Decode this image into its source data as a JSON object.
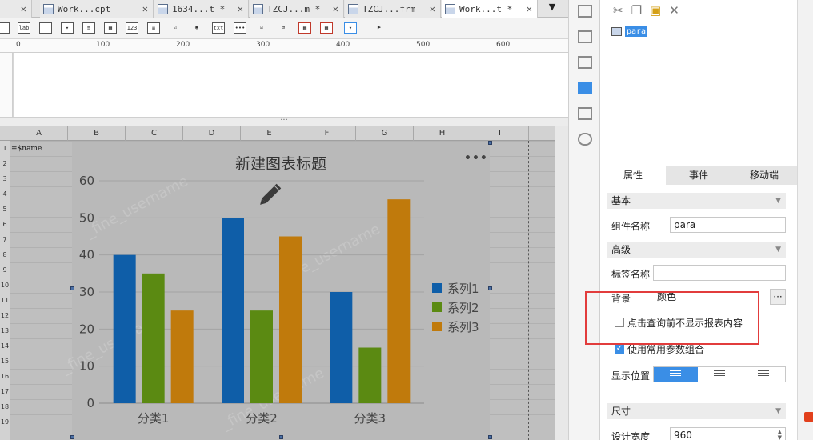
{
  "tabs": [
    {
      "label": "Work...cpt",
      "active": false
    },
    {
      "label": "1634...t *",
      "active": false
    },
    {
      "label": "TZCJ...m *",
      "active": false
    },
    {
      "label": "TZCJ...frm",
      "active": false
    },
    {
      "label": "Work...t *",
      "active": true
    }
  ],
  "toolbar_labels": {
    "lab": "lab",
    "num": "123",
    "txt": "txt"
  },
  "ruler": [
    "0",
    "100",
    "200",
    "300",
    "400",
    "500",
    "600"
  ],
  "columns": [
    "A",
    "B",
    "C",
    "D",
    "E",
    "F",
    "G",
    "H",
    "I"
  ],
  "rows": [
    "1",
    "2",
    "3",
    "4",
    "5",
    "6",
    "7",
    "8",
    "9",
    "10",
    "11",
    "12",
    "13",
    "14",
    "15",
    "16",
    "17",
    "18",
    "19"
  ],
  "cell_a1": "=$name",
  "widget_tree": {
    "item": "para"
  },
  "panel_tabs": [
    "属性",
    "事件",
    "移动端"
  ],
  "props": {
    "section_basic": "基本",
    "name_label": "组件名称",
    "name_value": "para",
    "section_advanced": "高级",
    "tag_label": "标签名称",
    "tag_value": "",
    "bg_label": "背景",
    "bg_value": "颜色",
    "more_btn": "···",
    "cb1_label": "点击查询前不显示报表内容",
    "cb1_checked": false,
    "cb2_label": "使用常用参数组合",
    "cb2_checked": true,
    "position_label": "显示位置",
    "section_size": "尺寸",
    "width_label": "设计宽度",
    "width_value": "960"
  },
  "watermark": "_fine_username",
  "chart_data": {
    "type": "bar",
    "title": "新建图表标题",
    "categories": [
      "分类1",
      "分类2",
      "分类3"
    ],
    "series": [
      {
        "name": "系列1",
        "color": "#0f5ea8",
        "values": [
          40,
          50,
          30
        ]
      },
      {
        "name": "系列2",
        "color": "#5b8a12",
        "values": [
          35,
          25,
          15
        ]
      },
      {
        "name": "系列3",
        "color": "#c07a0c",
        "values": [
          25,
          45,
          55
        ]
      }
    ],
    "ylim": [
      0,
      60
    ],
    "yticks": [
      "0",
      "10",
      "20",
      "30",
      "40",
      "50",
      "60"
    ],
    "legend": "right",
    "grid": true
  }
}
